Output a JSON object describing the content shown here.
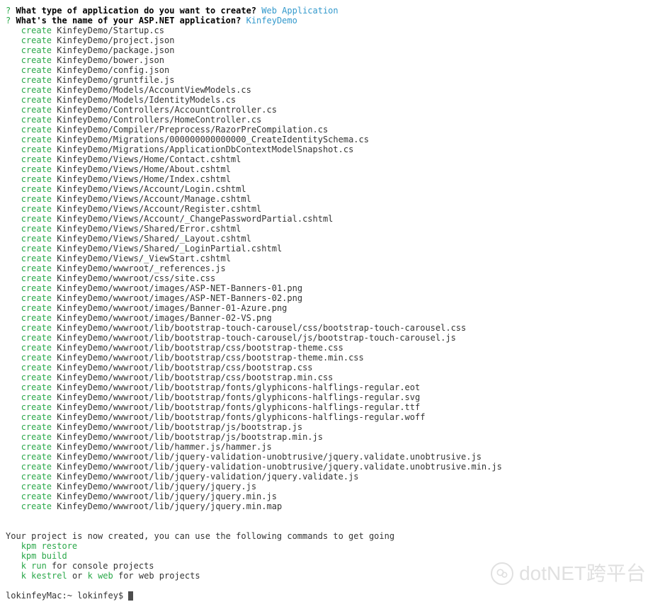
{
  "prompts": [
    {
      "marker": "?",
      "question": "What type of application do you want to create?",
      "answer": "Web Application"
    },
    {
      "marker": "?",
      "question": "What's the name of your ASP.NET application?",
      "answer": "KinfeyDemo"
    }
  ],
  "create_action": "create",
  "files": [
    "KinfeyDemo/Startup.cs",
    "KinfeyDemo/project.json",
    "KinfeyDemo/package.json",
    "KinfeyDemo/bower.json",
    "KinfeyDemo/config.json",
    "KinfeyDemo/gruntfile.js",
    "KinfeyDemo/Models/AccountViewModels.cs",
    "KinfeyDemo/Models/IdentityModels.cs",
    "KinfeyDemo/Controllers/AccountController.cs",
    "KinfeyDemo/Controllers/HomeController.cs",
    "KinfeyDemo/Compiler/Preprocess/RazorPreCompilation.cs",
    "KinfeyDemo/Migrations/000000000000000_CreateIdentitySchema.cs",
    "KinfeyDemo/Migrations/ApplicationDbContextModelSnapshot.cs",
    "KinfeyDemo/Views/Home/Contact.cshtml",
    "KinfeyDemo/Views/Home/About.cshtml",
    "KinfeyDemo/Views/Home/Index.cshtml",
    "KinfeyDemo/Views/Account/Login.cshtml",
    "KinfeyDemo/Views/Account/Manage.cshtml",
    "KinfeyDemo/Views/Account/Register.cshtml",
    "KinfeyDemo/Views/Account/_ChangePasswordPartial.cshtml",
    "KinfeyDemo/Views/Shared/Error.cshtml",
    "KinfeyDemo/Views/Shared/_Layout.cshtml",
    "KinfeyDemo/Views/Shared/_LoginPartial.cshtml",
    "KinfeyDemo/Views/_ViewStart.cshtml",
    "KinfeyDemo/wwwroot/_references.js",
    "KinfeyDemo/wwwroot/css/site.css",
    "KinfeyDemo/wwwroot/images/ASP-NET-Banners-01.png",
    "KinfeyDemo/wwwroot/images/ASP-NET-Banners-02.png",
    "KinfeyDemo/wwwroot/images/Banner-01-Azure.png",
    "KinfeyDemo/wwwroot/images/Banner-02-VS.png",
    "KinfeyDemo/wwwroot/lib/bootstrap-touch-carousel/css/bootstrap-touch-carousel.css",
    "KinfeyDemo/wwwroot/lib/bootstrap-touch-carousel/js/bootstrap-touch-carousel.js",
    "KinfeyDemo/wwwroot/lib/bootstrap/css/bootstrap-theme.css",
    "KinfeyDemo/wwwroot/lib/bootstrap/css/bootstrap-theme.min.css",
    "KinfeyDemo/wwwroot/lib/bootstrap/css/bootstrap.css",
    "KinfeyDemo/wwwroot/lib/bootstrap/css/bootstrap.min.css",
    "KinfeyDemo/wwwroot/lib/bootstrap/fonts/glyphicons-halflings-regular.eot",
    "KinfeyDemo/wwwroot/lib/bootstrap/fonts/glyphicons-halflings-regular.svg",
    "KinfeyDemo/wwwroot/lib/bootstrap/fonts/glyphicons-halflings-regular.ttf",
    "KinfeyDemo/wwwroot/lib/bootstrap/fonts/glyphicons-halflings-regular.woff",
    "KinfeyDemo/wwwroot/lib/bootstrap/js/bootstrap.js",
    "KinfeyDemo/wwwroot/lib/bootstrap/js/bootstrap.min.js",
    "KinfeyDemo/wwwroot/lib/hammer.js/hammer.js",
    "KinfeyDemo/wwwroot/lib/jquery-validation-unobtrusive/jquery.validate.unobtrusive.js",
    "KinfeyDemo/wwwroot/lib/jquery-validation-unobtrusive/jquery.validate.unobtrusive.min.js",
    "KinfeyDemo/wwwroot/lib/jquery-validation/jquery.validate.js",
    "KinfeyDemo/wwwroot/lib/jquery/jquery.js",
    "KinfeyDemo/wwwroot/lib/jquery/jquery.min.js",
    "KinfeyDemo/wwwroot/lib/jquery/jquery.min.map"
  ],
  "footer": {
    "message": "Your project is now created, you can use the following commands to get going",
    "cmd1": "kpm restore",
    "cmd2": "kpm build",
    "cmd3_green": "k run",
    "cmd3_rest": " for console projects",
    "cmd4_green1": "k kestrel",
    "cmd4_mid": " or ",
    "cmd4_green2": "k web",
    "cmd4_rest": " for web projects"
  },
  "prompt_line": {
    "host": "lokinfeyMac:~ lokinfey$ "
  },
  "watermark": {
    "text": "dotNET跨平台"
  }
}
